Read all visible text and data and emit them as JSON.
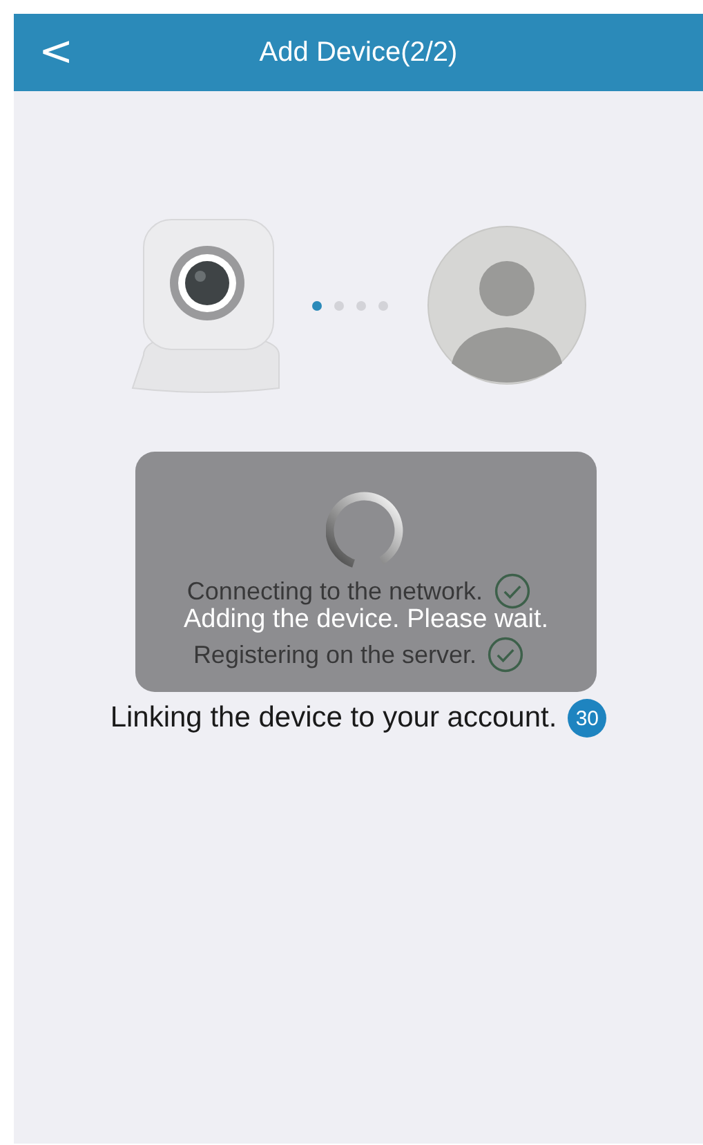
{
  "header": {
    "back": "<",
    "title": "Add Device(2/2)"
  },
  "progress_dots": [
    {
      "selected": true
    },
    {
      "selected": false
    },
    {
      "selected": false
    },
    {
      "selected": false
    }
  ],
  "steps": [
    {
      "kind": "done",
      "label": "Connecting to the network."
    },
    {
      "kind": "done",
      "label": "Registering on the server."
    },
    {
      "kind": "countdown",
      "label": "Linking the device to your account.",
      "count": "30"
    }
  ],
  "overlay": {
    "message": "Adding the device. Please wait."
  }
}
